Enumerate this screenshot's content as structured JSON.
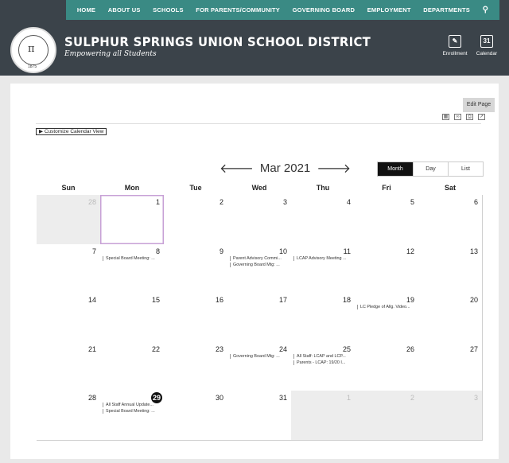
{
  "nav": {
    "items": [
      "HOME",
      "ABOUT US",
      "SCHOOLS",
      "FOR PARENTS/COMMUNITY",
      "GOVERNING BOARD",
      "EMPLOYMENT",
      "DEPARTMENTS"
    ],
    "search_icon": "search-icon"
  },
  "header": {
    "title": "SULPHUR SPRINGS UNION SCHOOL DISTRICT",
    "tagline": "Empowering all Students",
    "logo": {
      "year": "1875"
    },
    "links": [
      {
        "label": "Enrollment",
        "icon": "clipboard-icon"
      },
      {
        "label": "Calendar",
        "icon": "calendar-icon",
        "icon_text": "31"
      }
    ]
  },
  "page": {
    "edit_label": "Edit Page",
    "tools": [
      "calendar-icon",
      "link-icon",
      "print-icon",
      "external-link-icon"
    ],
    "customize_label": "Customize Calendar View"
  },
  "calendar": {
    "month_label": "Mar 2021",
    "views": [
      "Month",
      "Day",
      "List"
    ],
    "active_view": "Month",
    "weekdays": [
      "Sun",
      "Mon",
      "Tue",
      "Wed",
      "Thu",
      "Fri",
      "Sat"
    ],
    "weeks": [
      [
        {
          "d": "28",
          "o": true
        },
        {
          "d": "1",
          "sel": true
        },
        {
          "d": "2"
        },
        {
          "d": "3"
        },
        {
          "d": "4"
        },
        {
          "d": "5"
        },
        {
          "d": "6"
        }
      ],
      [
        {
          "d": "7"
        },
        {
          "d": "8",
          "ev": [
            "Special Board Meeting: ..."
          ]
        },
        {
          "d": "9"
        },
        {
          "d": "10",
          "ev": [
            "Parent Advisory Commi...",
            "Governing Board Mtg: ..."
          ]
        },
        {
          "d": "11",
          "ev": [
            "LCAP Advisory Meeting ..."
          ]
        },
        {
          "d": "12"
        },
        {
          "d": "13"
        }
      ],
      [
        {
          "d": "14"
        },
        {
          "d": "15"
        },
        {
          "d": "16"
        },
        {
          "d": "17"
        },
        {
          "d": "18"
        },
        {
          "d": "19",
          "ev": [
            "LC Pledge of Allg. Video..."
          ]
        },
        {
          "d": "20"
        }
      ],
      [
        {
          "d": "21"
        },
        {
          "d": "22"
        },
        {
          "d": "23"
        },
        {
          "d": "24",
          "ev": [
            "Governing Board Mtg: ..."
          ]
        },
        {
          "d": "25",
          "ev": [
            "All Staff: LCAP and LCP...",
            "Parents - LCAP: 19/20 I..."
          ]
        },
        {
          "d": "26"
        },
        {
          "d": "27"
        }
      ],
      [
        {
          "d": "28"
        },
        {
          "d": "29",
          "today": true,
          "ev": [
            "All Staff Annual Update...",
            "Special Board Meeting: ..."
          ]
        },
        {
          "d": "30"
        },
        {
          "d": "31"
        },
        {
          "d": "1",
          "o": true
        },
        {
          "d": "2",
          "o": true
        },
        {
          "d": "3",
          "o": true
        }
      ]
    ]
  }
}
